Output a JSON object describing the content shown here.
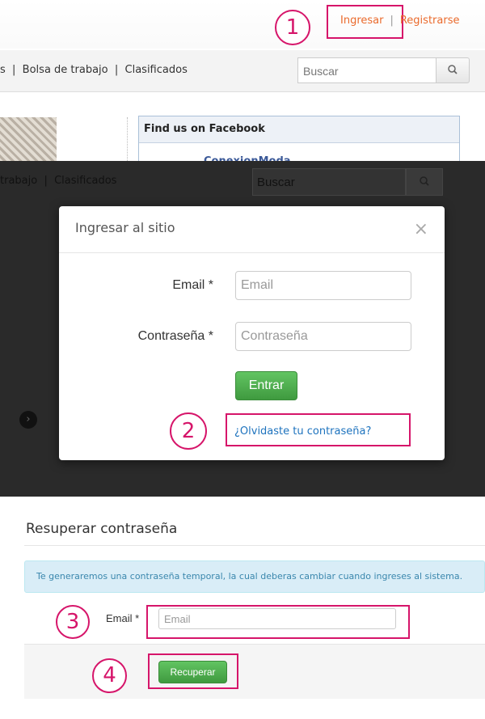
{
  "callouts": {
    "step1": "1",
    "step2": "2",
    "step3": "3",
    "step4": "4",
    "highlight_color": "#d6156a"
  },
  "site_header": {
    "login_link": "Ingresar",
    "separator": "|",
    "register_link": "Registrarse",
    "link_color": "#ea6a2c"
  },
  "navbar": {
    "items_text": "s  |  Bolsa de trabajo  |  Clasificados",
    "search_placeholder": "Buscar",
    "search_icon": "magnifier-icon"
  },
  "facebook_box": {
    "title": "Find us on Facebook",
    "page_name": "ConexionModa"
  },
  "overlay": {
    "nav_text": "trabajo  |  Clasificados",
    "search_placeholder": "Buscar",
    "carousel_arrow": "›"
  },
  "login_modal": {
    "title": "Ingresar al sitio",
    "close": "×",
    "email_label": "Email *",
    "email_placeholder": "Email",
    "password_label": "Contraseña *",
    "password_placeholder": "Contraseña",
    "submit": "Entrar",
    "forgot_link": "¿Olvidaste tu contraseña?",
    "button_color": "#51a351"
  },
  "recover": {
    "title": "Resuperar contraseña",
    "info": "Te generaremos una contraseña temporal, la cual deberas cambiar cuando ingreses al sistema.",
    "email_label": "Email *",
    "email_placeholder": "Email",
    "submit": "Recuperar"
  }
}
